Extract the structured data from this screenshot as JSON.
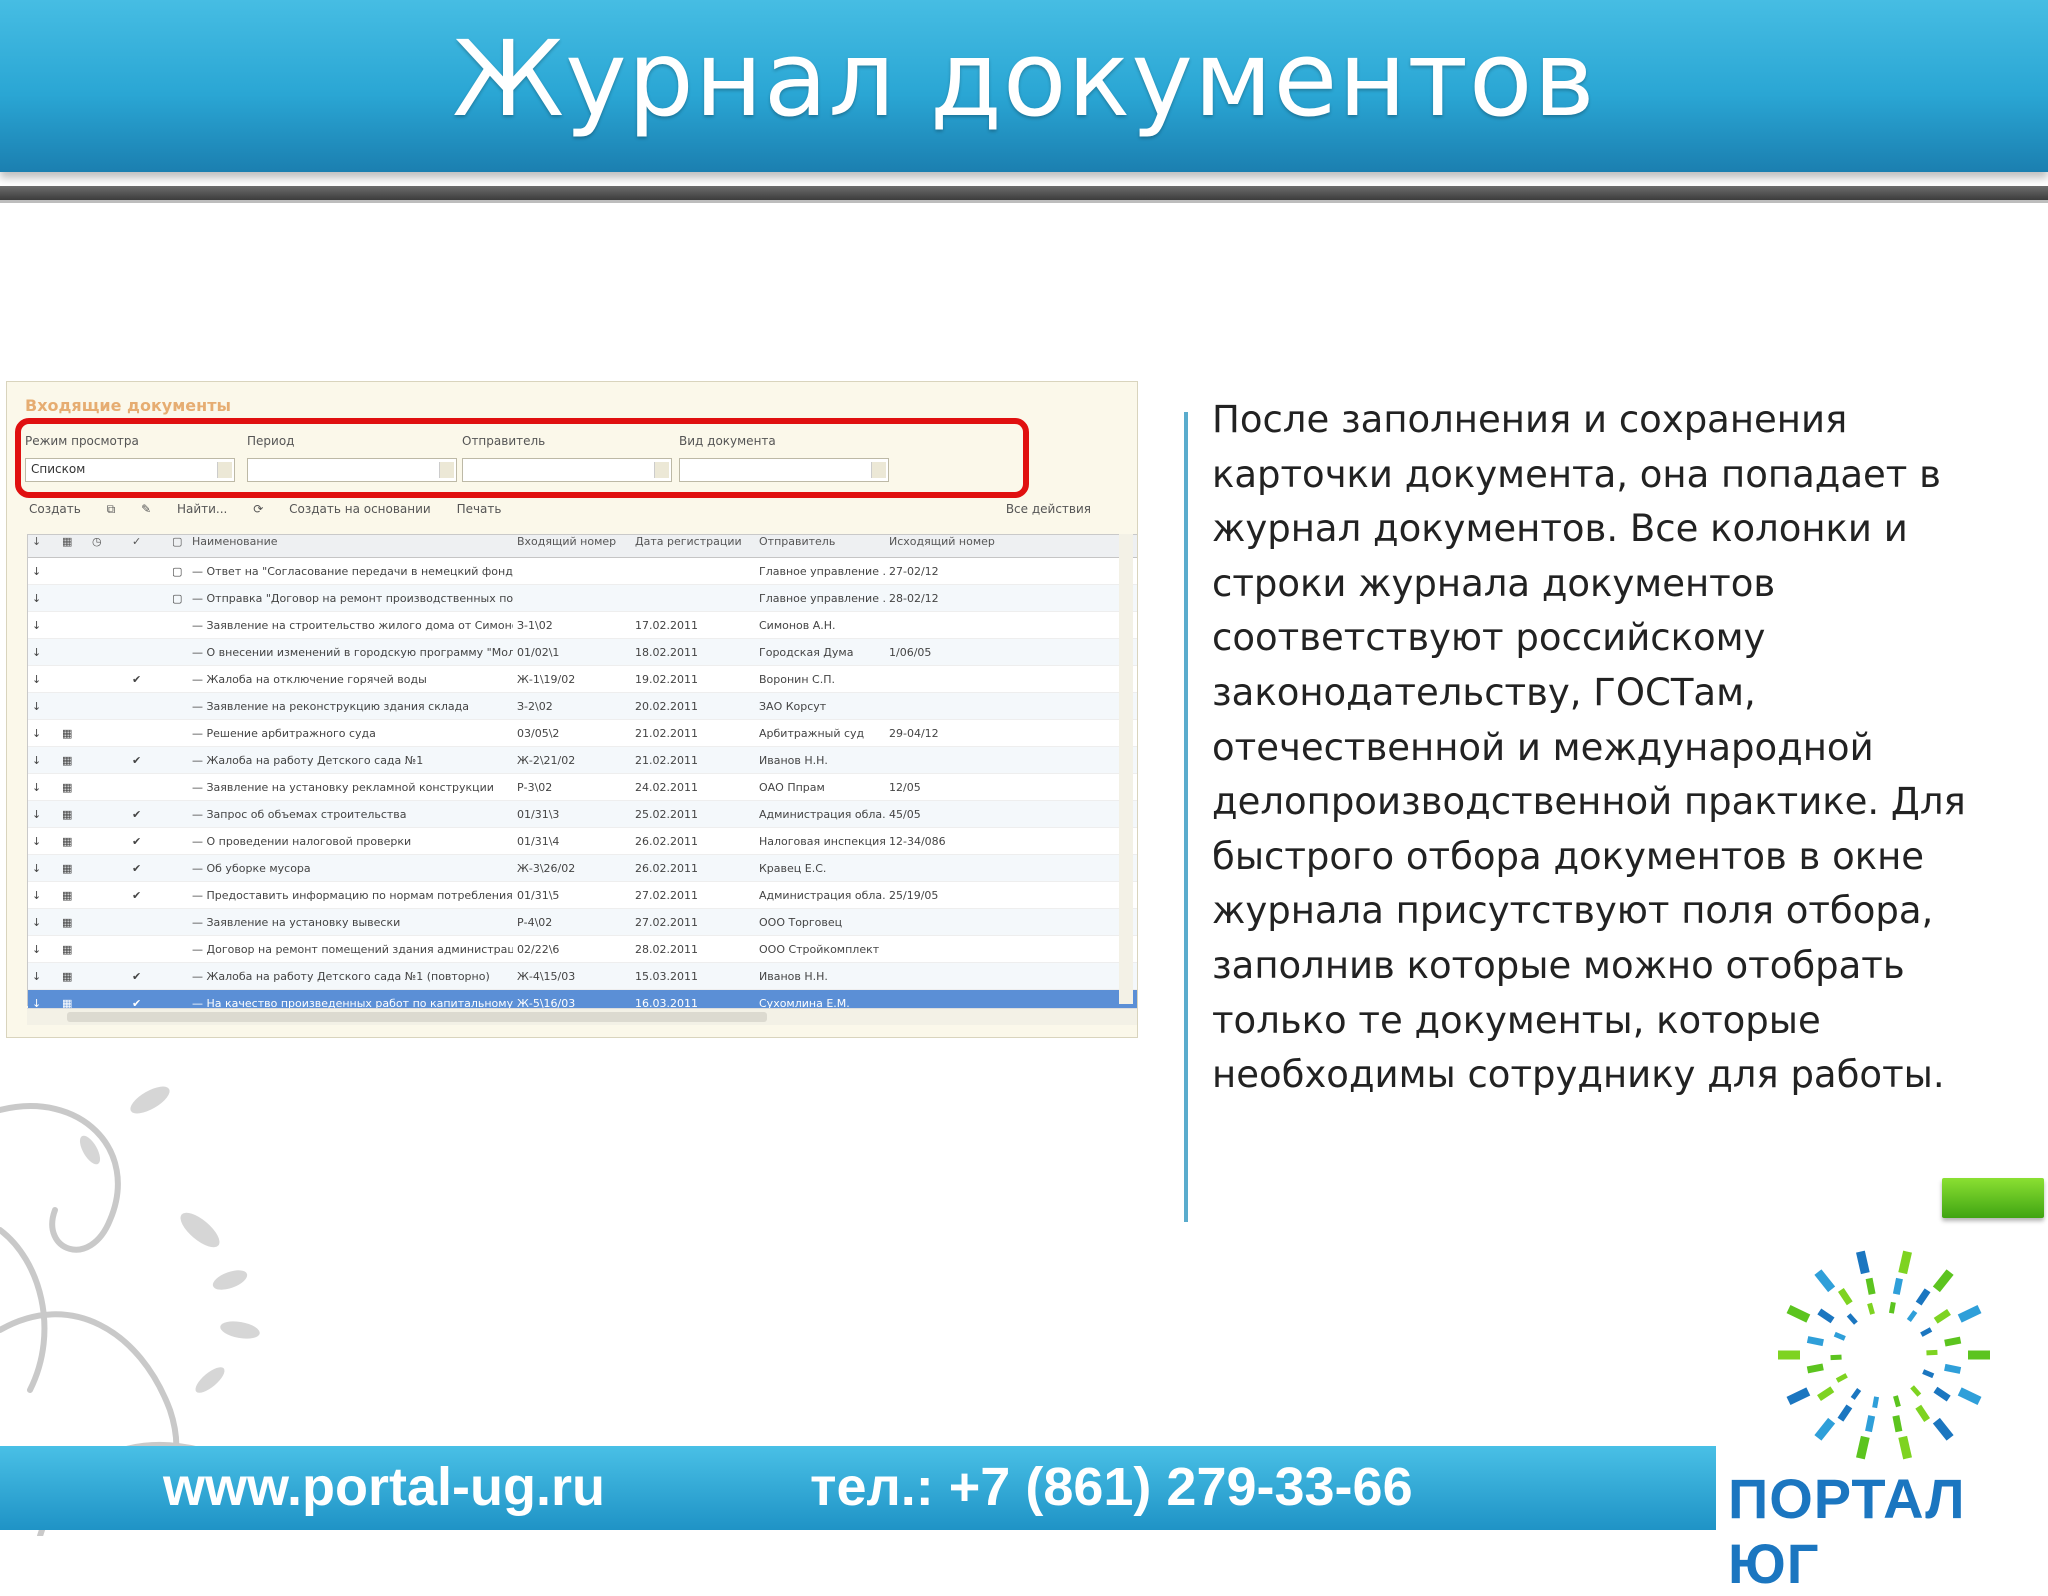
{
  "slide": {
    "title": "Журнал документов",
    "description": "После заполнения и сохранения карточки документа, она попадает в журнал документов. Все колонки и строки журнала документов соответствуют российскому законодательству, ГОСТам, отечественной и международной делопроизводственной практике. Для быстрого отбора документов в окне журнала присутствуют поля отбора, заполнив которые можно отобрать только те документы, которые необходимы сотруднику для работы."
  },
  "footer": {
    "url": "www.portal-ug.ru",
    "phone": "тел.: +7 (861) 279-33-66"
  },
  "logo": {
    "text": "ПОРТАЛ ЮГ"
  },
  "colors": {
    "header_blue": "#2aa6d4",
    "highlight_red": "#e01010",
    "accent_green": "#5cc41f",
    "logo_blue": "#1b76c0"
  },
  "app": {
    "window_title": "Входящие документы",
    "filters": [
      {
        "label": "Режим просмотра",
        "value": "Списком"
      },
      {
        "label": "Период",
        "value": ""
      },
      {
        "label": "Отправитель",
        "value": ""
      },
      {
        "label": "Вид документа",
        "value": ""
      }
    ],
    "toolbar": {
      "create": "Создать",
      "find": "Найти...",
      "create_basis": "Создать на основании",
      "print": "Печать",
      "all_actions": "Все действия"
    },
    "columns": [
      "Наименование",
      "Входящий номер",
      "Дата регистрации",
      "Отправитель",
      "Исходящий номер"
    ],
    "rows": [
      {
        "name": "Ответ на \"Согласование передачи в немецкий фонд\"",
        "num": "",
        "date": "",
        "sender": "Главное управление ...",
        "out": "27-02/12",
        "check": ""
      },
      {
        "name": "Отправка \"Договор на ремонт производственных пом...",
        "num": "",
        "date": "",
        "sender": "Главное управление ...",
        "out": "28-02/12",
        "check": ""
      },
      {
        "name": "Заявление на строительство жилого дома от Симонова",
        "num": "З-1\\02",
        "date": "17.02.2011",
        "sender": "Симонов А.Н.",
        "out": "",
        "check": ""
      },
      {
        "name": "О внесении изменений в городскую программу \"Моло...",
        "num": "01/02\\1",
        "date": "18.02.2011",
        "sender": "Городская Дума",
        "out": "1/06/05",
        "check": ""
      },
      {
        "name": "Жалоба на отключение горячей воды",
        "num": "Ж-1\\19/02",
        "date": "19.02.2011",
        "sender": "Воронин С.П.",
        "out": "",
        "check": "✔"
      },
      {
        "name": "Заявление на реконструкцию здания склада",
        "num": "З-2\\02",
        "date": "20.02.2011",
        "sender": "ЗАО Корсут",
        "out": "",
        "check": ""
      },
      {
        "name": "Решение арбитражного суда",
        "num": "03/05\\2",
        "date": "21.02.2011",
        "sender": "Арбитражный суд",
        "out": "29-04/12",
        "check": ""
      },
      {
        "name": "Жалоба на работу Детского сада №1",
        "num": "Ж-2\\21/02",
        "date": "21.02.2011",
        "sender": "Иванов Н.Н.",
        "out": "",
        "check": "✔"
      },
      {
        "name": "Заявление на установку рекламной конструкции",
        "num": "Р-3\\02",
        "date": "24.02.2011",
        "sender": "ОАО Ппрам",
        "out": "12/05",
        "check": ""
      },
      {
        "name": "Запрос об объемах строительства",
        "num": "01/31\\3",
        "date": "25.02.2011",
        "sender": "Администрация обла...",
        "out": "45/05",
        "check": "✔"
      },
      {
        "name": "О проведении налоговой проверки",
        "num": "01/31\\4",
        "date": "26.02.2011",
        "sender": "Налоговая инспекция",
        "out": "12-34/086",
        "check": "✔"
      },
      {
        "name": "Об уборке мусора",
        "num": "Ж-3\\26/02",
        "date": "26.02.2011",
        "sender": "Кравец Е.С.",
        "out": "",
        "check": "✔"
      },
      {
        "name": "Предоставить информацию по нормам потребления",
        "num": "01/31\\5",
        "date": "27.02.2011",
        "sender": "Администрация обла...",
        "out": "25/19/05",
        "check": "✔"
      },
      {
        "name": "Заявление на установку вывески",
        "num": "Р-4\\02",
        "date": "27.02.2011",
        "sender": "ООО Торговец",
        "out": "",
        "check": ""
      },
      {
        "name": "Договор на ремонт помещений здания администрации",
        "num": "02/22\\6",
        "date": "28.02.2011",
        "sender": "ООО Стройкомплект",
        "out": "",
        "check": ""
      },
      {
        "name": "Жалоба на работу Детского сада №1 (повторно)",
        "num": "Ж-4\\15/03",
        "date": "15.03.2011",
        "sender": "Иванов Н.Н.",
        "out": "",
        "check": "✔"
      },
      {
        "name": "На качество произведенных работ по капитальному р...",
        "num": "Ж-5\\16/03",
        "date": "16.03.2011",
        "sender": "Сухомлина Е.М.",
        "out": "",
        "check": "✔"
      }
    ]
  }
}
